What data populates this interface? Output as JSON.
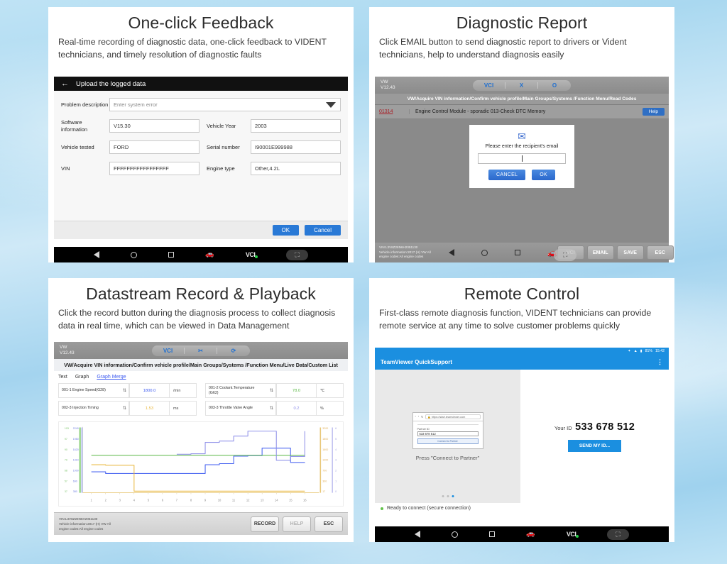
{
  "panels": {
    "one_click": {
      "title": "One-click Feedback",
      "subtitle": "Real-time recording of diagnostic data, one-click feedback to VIDENT technicians, and timely resolution of diagnostic faults",
      "topbar_title": "Upload the logged data",
      "back_icon": "back-arrow-icon",
      "fields": {
        "problem_label": "Problem description",
        "problem_placeholder": "Enter system error",
        "software_label": "Software information",
        "software_value": "V15.30",
        "vehicle_year_label": "Vehicle Year",
        "vehicle_year_value": "2003",
        "vehicle_tested_label": "Vehicle tested",
        "vehicle_tested_value": "FORD",
        "serial_label": "Serial number",
        "serial_value": "I90001E999988",
        "vin_label": "VIN",
        "vin_value": "FFFFFFFFFFFFFFFFF",
        "engine_label": "Engine type",
        "engine_value": "Other,4.2L"
      },
      "ok_label": "OK",
      "cancel_label": "Cancel",
      "nav": {
        "vci_label": "VCI"
      }
    },
    "diagnostic_report": {
      "title": "Diagnostic Report",
      "subtitle": "Click EMAIL button to send diagnostic report to drivers or Vident technicians, help to understand diagnosis easily",
      "device": {
        "make": "VW",
        "version": "V12.43"
      },
      "toolbar": [
        "VCI",
        "X",
        "O"
      ],
      "breadcrumb": "VW/Acquire VIN information/Confirm vehicle profile/Main Groups/Systems /Function Menu/Read Codes",
      "dtc": {
        "code": "01314",
        "description": "Engine Control Module - sporadic 013-Check DTC Memory",
        "help_label": "Help"
      },
      "dialog": {
        "icon": "mail-icon",
        "prompt": "Please enter the recipient's email",
        "input_value": "",
        "cancel_label": "CANCEL",
        "ok_label": "OK"
      },
      "footer": {
        "vin_line1": "VIN:L3V8Z28N6H2051130",
        "vin_line2": "Vehicle information:2017 (H) VW  All",
        "vin_line3": "engine codes:All engine codes",
        "keys": [
          "VCI",
          "EMAIL",
          "SAVE",
          "ESC"
        ]
      }
    },
    "datastream": {
      "title": "Datastream Record & Playback",
      "subtitle": "Click the record button during the diagnosis process to collect diagnosis data in real time, which can be viewed in Data Management",
      "device": {
        "make": "VW",
        "version": "V12.43"
      },
      "breadcrumb": "VW/Acquire VIN information/Confirm vehicle profile/Main Groups/Systems /Function Menu/Live Data/Custom List",
      "tabs": [
        "Text",
        "Graph",
        "Graph Merge"
      ],
      "active_tab": "Graph Merge",
      "items": [
        {
          "name": "001-1 Engine Speed(G28)",
          "value": "1800.0",
          "unit": "/min",
          "color": "#3d5af0"
        },
        {
          "name": "001-2 Coolant.Temperature (G62)",
          "value": "78.0",
          "unit": "℃",
          "color": "#5fba4a"
        },
        {
          "name": "002-3 Injection Timing",
          "value": "1.53",
          "unit": "ms",
          "color": "#e8b63c"
        },
        {
          "name": "003-3 Throttle Valve Angle",
          "value": "0.2",
          "unit": "%",
          "color": "#8b8ce8"
        }
      ],
      "footer": {
        "vin_line1": "VIN:L3V8Z28N6H2051130",
        "vin_line2": "Vehicle information:2017 (H) VW  All",
        "vin_line3": "engine codes:All engine codes",
        "keys": [
          "RECORD",
          "HELP",
          "ESC"
        ]
      }
    },
    "remote_control": {
      "title": "Remote Control",
      "subtitle": "First-class remote diagnosis function, VIDENT technicians can provide remote service at any time to solve customer problems quickly",
      "status": {
        "battery": "81%",
        "time": "15:42"
      },
      "app_title": "TeamViewer QuickSupport",
      "menu_icon": "kebab-menu-icon",
      "left": {
        "url": "https://start.teamviewer.com",
        "partner_label": "Partner ID",
        "partner_id": "533 678 512",
        "connect_label": "Connect to Partner",
        "press_text": "Press \"Connect to Partner\"",
        "carousel_active": 2
      },
      "right": {
        "your_id_label": "Your ID",
        "id_value": "533 678 512",
        "send_label": "SEND MY ID..."
      },
      "status_text": "Ready to connect (secure connection)",
      "nav": {
        "vci_label": "VCI"
      }
    }
  },
  "chart_data": {
    "type": "line",
    "title": "",
    "xlabel": "",
    "ylabel": "",
    "x": [
      1,
      2,
      3,
      4,
      5,
      6,
      7,
      8,
      9,
      10,
      11,
      12,
      13,
      14,
      15,
      16
    ],
    "xlim": [
      0,
      17
    ],
    "left_axis_ticks_blue": [
      "2240",
      "1980",
      "1620",
      "1310",
      "1000",
      "690",
      "380"
    ],
    "left_axis_ticks_green": [
      "103",
      "97",
      "90",
      "79",
      "68",
      "57",
      "37"
    ],
    "right_axis_ticks_orange": [
      "3200",
      "1800",
      "1600",
      "1200",
      "700",
      "300",
      "17"
    ],
    "right_axis_ticks_purple": [
      "6",
      "5",
      "4",
      "3",
      "2",
      "1",
      "0"
    ],
    "grid": false,
    "legend": "none",
    "series": [
      {
        "name": "001-1 Engine Speed(G28)",
        "color": "#3d5af0",
        "values": [
          760,
          700,
          700,
          700,
          700,
          700,
          700,
          700,
          1020,
          1060,
          1330,
          1350,
          1620,
          1620,
          1100,
          1105
        ]
      },
      {
        "name": "001-2 Coolant.Temperature (G62)",
        "color": "#5fba4a",
        "values": [
          1360,
          1360,
          1360,
          1360,
          1360,
          1360,
          1360,
          1360,
          1360,
          1360,
          1360,
          1360,
          1360,
          1360,
          1360,
          1360
        ]
      },
      {
        "name": "002-3 Injection Timing",
        "color": "#e8b63c",
        "values": [
          1020,
          1000,
          1000,
          60,
          60,
          60,
          60,
          60,
          60,
          60,
          60,
          60,
          60,
          60,
          60,
          60
        ]
      },
      {
        "name": "003-3 Throttle Valve Angle",
        "color": "#8b8ce8",
        "values": [
          null,
          null,
          null,
          null,
          null,
          null,
          1400,
          1420,
          1830,
          1880,
          2060,
          2240,
          2240,
          1180,
          1320,
          2240
        ]
      }
    ]
  }
}
